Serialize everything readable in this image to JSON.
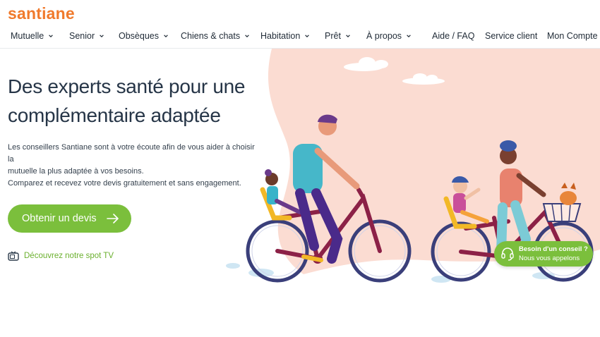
{
  "brand": {
    "logo_text": "santiane",
    "color": "#f07a2c"
  },
  "nav": {
    "items": [
      {
        "label": "Mutuelle",
        "has_dropdown": true
      },
      {
        "label": "Senior",
        "has_dropdown": true
      },
      {
        "label": "Obsèques",
        "has_dropdown": true
      },
      {
        "label": "Chiens & chats",
        "has_dropdown": true
      },
      {
        "label": "Habitation",
        "has_dropdown": true
      },
      {
        "label": "Prêt",
        "has_dropdown": true
      },
      {
        "label": "À propos",
        "has_dropdown": true
      }
    ],
    "right_links": [
      {
        "label": "Aide / FAQ"
      },
      {
        "label": "Service client"
      },
      {
        "label": "Mon Compte"
      }
    ]
  },
  "hero": {
    "title_line1": "Des experts santé pour une",
    "title_line2": "complémentaire adaptée",
    "description_line1": "Les conseillers Santiane sont à votre écoute afin de vous aider à choisir la",
    "description_line2": "mutuelle la plus adaptée à vos besoins.",
    "description_line3": "Comparez et recevez votre devis gratuitement et sans engagement.",
    "cta_label": "Obtenir un devis",
    "tv_link_label": "Découvrez notre spot TV",
    "illustration": "family-riding-bicycles"
  },
  "callback_widget": {
    "line1": "Besoin d'un conseil ?",
    "line2": "Nous vous appelons",
    "icon": "headset-icon"
  },
  "colors": {
    "accent_green": "#7bbf3c",
    "brand_orange": "#f07a2c",
    "hero_peach": "#fbdcd2",
    "title_text": "#263547"
  }
}
